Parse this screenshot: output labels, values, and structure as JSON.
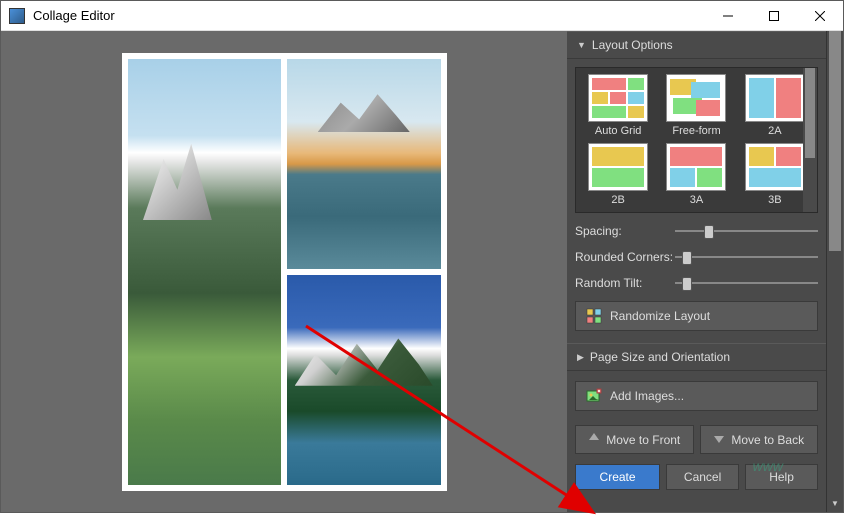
{
  "window": {
    "title": "Collage Editor"
  },
  "sections": {
    "layout_options": "Layout Options",
    "page_size": "Page Size and Orientation"
  },
  "layouts": {
    "auto_grid": "Auto Grid",
    "free_form": "Free-form",
    "l2a": "2A",
    "l2b": "2B",
    "l3a": "3A",
    "l3b": "3B"
  },
  "sliders": {
    "spacing": "Spacing:",
    "rounded": "Rounded Corners:",
    "tilt": "Random Tilt:"
  },
  "buttons": {
    "randomize": "Randomize Layout",
    "add_images": "Add Images...",
    "move_front": "Move to Front",
    "move_back": "Move to Back",
    "create": "Create",
    "cancel": "Cancel",
    "help": "Help"
  },
  "slider_values": {
    "spacing_pct": 20,
    "rounded_pct": 5,
    "tilt_pct": 5
  },
  "watermark": "www"
}
